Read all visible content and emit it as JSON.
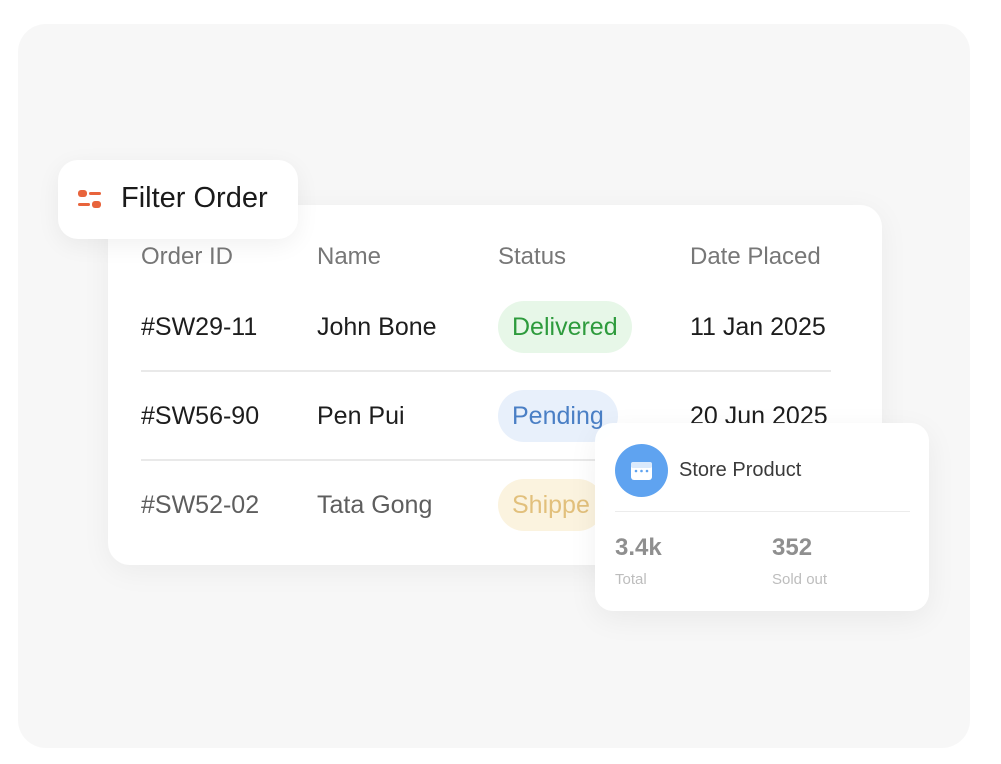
{
  "filter": {
    "label": "Filter Order",
    "icon": "filter-sliders-icon",
    "icon_color": "#e8643c"
  },
  "table": {
    "headers": {
      "order_id": "Order ID",
      "name": "Name",
      "status": "Status",
      "date_placed": "Date Placed"
    },
    "rows": [
      {
        "order_id": "#SW29-11",
        "name": "John Bone",
        "status": "Delivered",
        "date": "11 Jan 2025"
      },
      {
        "order_id": "#SW56-90",
        "name": "Pen Pui",
        "status": "Pending",
        "date": "20 Jun 2025"
      },
      {
        "order_id": "#SW52-02",
        "name": "Tata Gong",
        "status": "Shippe"
      }
    ]
  },
  "status_colors": {
    "delivered": "#2e9b3d",
    "pending": "#4a7fc5",
    "shipped": "#e2c07c"
  },
  "store_card": {
    "title": "Store Product",
    "icon": "storefront-icon",
    "icon_color": "#5fa3f0",
    "stats": {
      "total_value": "3.4k",
      "total_label": "Total",
      "sold_value": "352",
      "sold_label": "Sold out"
    }
  }
}
